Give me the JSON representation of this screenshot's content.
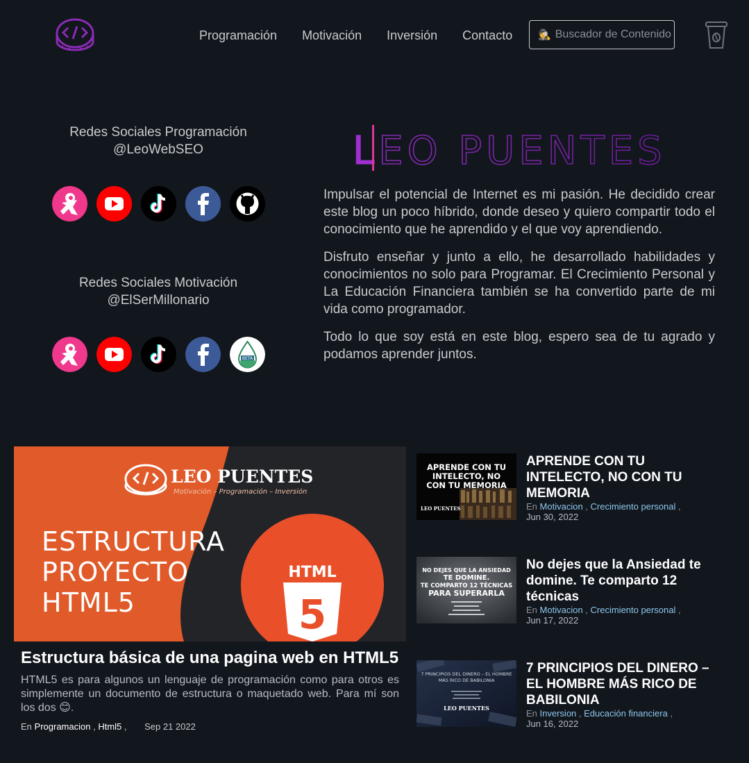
{
  "header": {
    "logo_alt": "Leo Puentes logo",
    "nav": [
      "Programación",
      "Motivación",
      "Inversión",
      "Contacto"
    ],
    "search_label": "Buscador de Contenido",
    "search_icon": "spy-icon",
    "coffee_icon": "coffee-cup-icon"
  },
  "social": {
    "programming": {
      "title": "Redes Sociales Programación",
      "handle": "@LeoWebSEO",
      "icons": [
        "hive-icon",
        "youtube-icon",
        "tiktok-icon",
        "facebook-icon",
        "github-icon"
      ]
    },
    "motivation": {
      "title": "Redes Sociales Motivación",
      "handle": "@ElSerMillonario",
      "icons": [
        "hive-icon",
        "youtube-icon",
        "tiktok-icon",
        "facebook-icon",
        "beta-drop-icon"
      ]
    }
  },
  "hero": {
    "title": "LEO PUENTES",
    "paragraphs": [
      "Impulsar el potencial de Internet es mi pasión. He decidido crear este blog un poco híbrido, donde deseo y quiero compartir todo el conocimiento que he aprendido y el que voy aprendiendo.",
      "Disfruto enseñar y junto a ello, he desarrollado habilidades y conocimientos no solo para Programar. El Crecimiento Personal y La Educación Financiera también se ha convertido parte de mi vida como programador.",
      "Todo lo que soy está en este blog, espero sea de tu agrado y podamos aprender juntos."
    ]
  },
  "featured": {
    "image": {
      "brand": "LEO PUENTES",
      "tagline": "Motivación  –  Programación  –  Inversión",
      "heading_lines": [
        "ESTRUCTURA",
        "PROYECTO",
        "HTML5"
      ],
      "badge_text": "HTML",
      "badge_num": "5"
    },
    "title": "Estructura básica de una pagina web en HTML5",
    "description": "HTML5 es para algunos un lenguaje de programación como para otros es simplemente un documento de estructura o maquetado web. Para mí son los dos 😊.",
    "meta_prefix": "En",
    "categories": [
      "Programacion",
      "Html5"
    ],
    "date": "Sep 21 2022"
  },
  "posts": [
    {
      "thumb_lines": [
        "APRENDE CON TU",
        "INTELECTO, NO",
        "CON TU MEMORIA"
      ],
      "thumb_brand": "LEO PUENTES",
      "title": "APRENDE CON TU INTELECTO, NO CON TU MEMORIA",
      "meta_prefix": "En",
      "categories": [
        "Motivacion",
        "Crecimiento personal"
      ],
      "date": "Jun 30, 2022"
    },
    {
      "thumb_lines": [
        "NO DEJES QUE LA ANSIEDAD",
        "TE DOMINE.",
        "TE COMPARTO 12 TÉCNICAS",
        "PARA SUPERARLA"
      ],
      "thumb_brand": "",
      "title": "No dejes que la Ansiedad te domine. Te comparto 12 técnicas",
      "meta_prefix": "En",
      "categories": [
        "Motivacion",
        "Crecimiento personal"
      ],
      "date": "Jun 17, 2022"
    },
    {
      "thumb_lines": [
        "7 PRINCIPIOS DEL DINERO – EL HOMBRE",
        "MÁS RICO DE BABILONIA"
      ],
      "thumb_brand": "LEO PUENTES",
      "title": "7 PRINCIPIOS DEL DINERO – EL HOMBRE MÁS RICO DE BABILONIA",
      "meta_prefix": "En",
      "categories": [
        "Inversion",
        "Educación financiera"
      ],
      "date": "Jun 16, 2022"
    }
  ],
  "colors": {
    "background": "#12161d",
    "accent_purple": "#8a2bb5",
    "accent_pink": "#e0359c",
    "link_blue": "#8ec9ee",
    "featured_orange": "#e05a2a"
  }
}
